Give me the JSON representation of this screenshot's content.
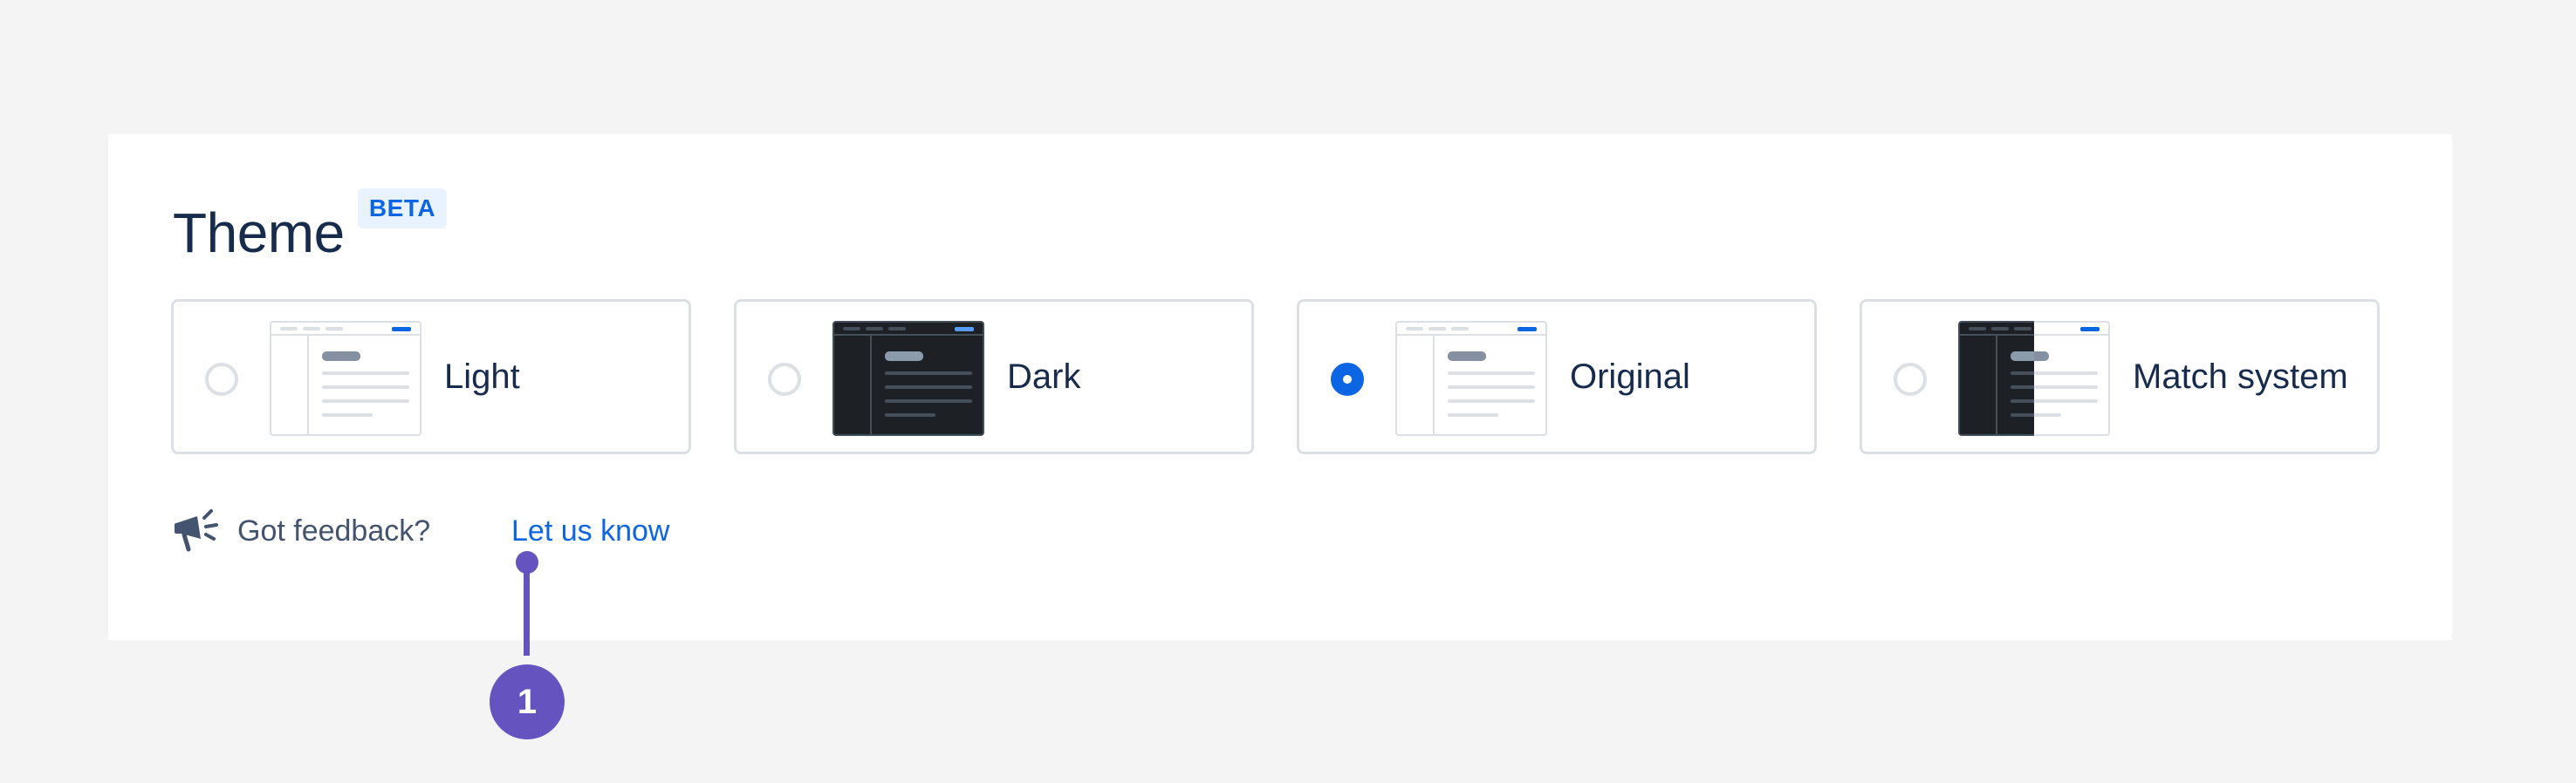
{
  "theme": {
    "title": "Theme",
    "badge": "BETA",
    "options": [
      {
        "label": "Light",
        "selected": false,
        "preview": "light"
      },
      {
        "label": "Dark",
        "selected": false,
        "preview": "dark"
      },
      {
        "label": "Original",
        "selected": true,
        "preview": "light"
      },
      {
        "label": "Match system",
        "selected": false,
        "preview": "split"
      }
    ]
  },
  "feedback": {
    "icon": "megaphone-icon",
    "text": "Got feedback?",
    "link": "Let us know"
  },
  "annotation": {
    "number": "1"
  },
  "colors": {
    "accent": "#0c66e4",
    "text": "#172b4d",
    "subtle_text": "#44546f",
    "border": "#dcdfe4",
    "annotation": "#6554c0",
    "badge_bg": "#e9f2ff"
  }
}
